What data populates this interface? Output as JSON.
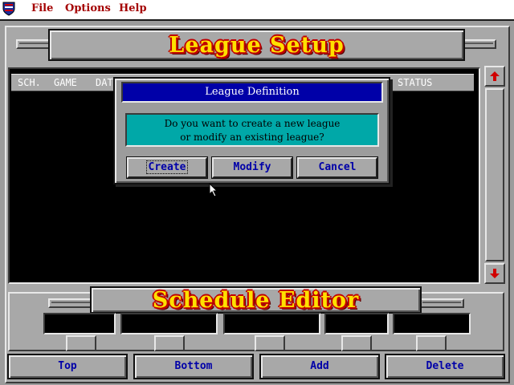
{
  "menu": {
    "items": [
      {
        "label": "File"
      },
      {
        "label": "Options"
      },
      {
        "label": "Help"
      }
    ]
  },
  "header": {
    "title": "League Setup"
  },
  "schedule_list": {
    "columns": [
      "SCH.",
      "GAME",
      "DAT",
      "STATUS"
    ],
    "rows": []
  },
  "dialog": {
    "title": "League Definition",
    "message_line1": "Do you want to create a new league",
    "message_line2": "or modify an existing league?",
    "buttons": [
      {
        "label": "Create",
        "focused": true
      },
      {
        "label": "Modify"
      },
      {
        "label": "Cancel"
      }
    ]
  },
  "editor": {
    "title": "Schedule Editor",
    "fields": [
      "",
      "",
      "",
      "",
      ""
    ]
  },
  "nav_buttons": [
    {
      "label": "Top"
    },
    {
      "label": "Bottom"
    },
    {
      "label": "Add"
    },
    {
      "label": "Delete"
    }
  ],
  "colors": {
    "menu_text": "#a40000",
    "title_bar": "#0000a8",
    "message_bg": "#00a8a8",
    "banner_fill": "#ffe000",
    "banner_outline": "#c00000",
    "button_text": "#0000a8"
  }
}
